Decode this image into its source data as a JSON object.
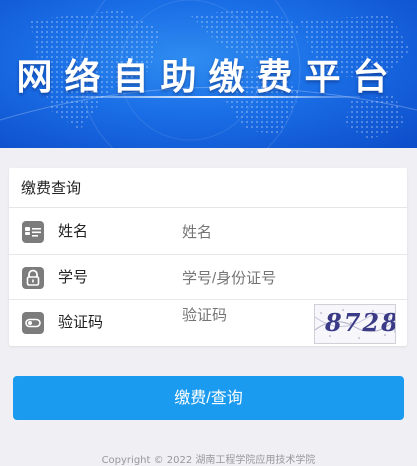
{
  "banner": {
    "title": "网络自助缴费平台"
  },
  "form": {
    "header": "缴费查询",
    "name_label": "姓名",
    "name_placeholder": "姓名",
    "id_label": "学号",
    "id_placeholder": "学号/身份证号",
    "captcha_label": "验证码",
    "captcha_placeholder": "验证码",
    "captcha_text": "8728"
  },
  "actions": {
    "submit_label": "缴费/查询"
  },
  "footer": {
    "copyright": "Copyright © 2022 湖南工程学院应用技术学院"
  },
  "colors": {
    "primary": "#1a9bf0",
    "banner": "#1a6ee6",
    "icon_bg": "#7c7c7c"
  },
  "icons": {
    "name": "id-card-icon",
    "id": "lock-icon",
    "captcha": "toggle-icon"
  }
}
